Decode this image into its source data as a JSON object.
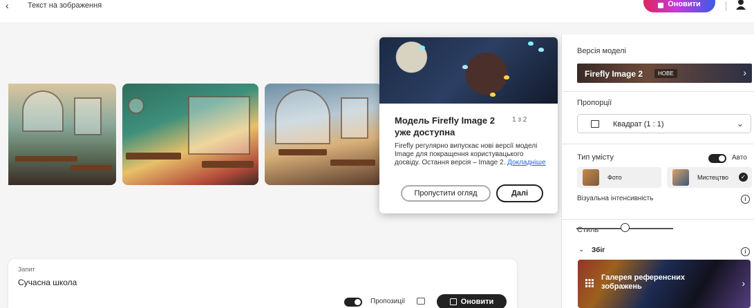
{
  "topbar": {
    "back_glyph": "‹",
    "breadcrumb": "Текст на зображення",
    "upgrade_label": "Оновити"
  },
  "popover": {
    "title": "Модель Firefly Image 2 уже доступна",
    "counter": "1 з 2",
    "body": "Firefly регулярно випускає нові версії моделі Image для покращення користувацького досвіду. Остання версія – Image 2.",
    "link": "Докладніше",
    "skip_label": "Пропустити огляд",
    "next_label": "Далі"
  },
  "panel": {
    "model_section": "Версія моделі",
    "model_name": "Firefly Image 2",
    "model_badge": "НОВЕ",
    "aspect_section": "Пропорції",
    "aspect_value": "Квадрат (1 : 1)",
    "content_type_section": "Тип умісту",
    "auto_label": "Авто",
    "auto_on": true,
    "content_types": [
      {
        "label": "Фото",
        "selected": false
      },
      {
        "label": "Мистецтво",
        "selected": true
      }
    ],
    "intensity_label": "Візуальна інтенсивність",
    "intensity_value": 0.5,
    "style_section": "Стиль",
    "collection_label": "Збіг",
    "gallery_label": "Галерея референсних зображень"
  },
  "prompt": {
    "label": "Запит",
    "value": "Сучасна школа",
    "suggestions_label": "Пропозиції",
    "suggestions_on": true,
    "generate_label": "Оновити"
  },
  "icons": {
    "back": "back-icon",
    "user": "user-icon",
    "chevron_right": "chevron-right-icon",
    "chevron_down": "chevron-down-icon",
    "info": "info-icon",
    "check": "check-icon",
    "grid": "grid-icon",
    "generate": "generate-icon"
  },
  "colors": {
    "upgrade_gradient": [
      "#e0245e",
      "#c43bd6",
      "#3d5ae8"
    ],
    "link": "#1a66d9",
    "primary_button": "#222222"
  }
}
